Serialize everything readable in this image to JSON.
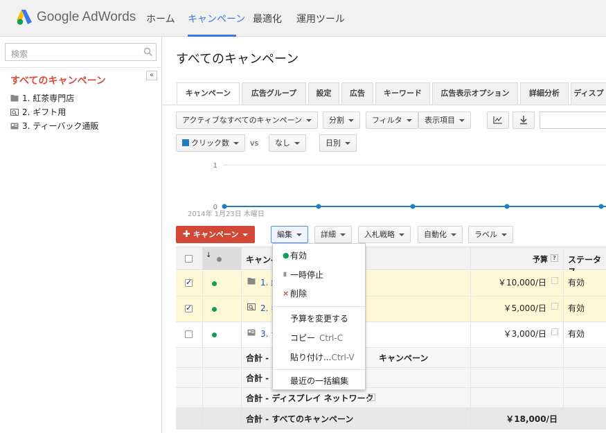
{
  "header": {
    "brand": "Google AdWords",
    "nav": [
      "ホーム",
      "キャンペーン",
      "最適化",
      "運用ツール"
    ],
    "active_nav": "キャンペーン"
  },
  "sidebar": {
    "search_placeholder": "検索",
    "title": "すべてのキャンペーン",
    "items": [
      {
        "label": "1. 紅茶専門店",
        "icon": "folder-icon"
      },
      {
        "label": "2. ギフト用",
        "icon": "search-campaign-icon"
      },
      {
        "label": "3. ティーバック通販",
        "icon": "display-campaign-icon"
      }
    ]
  },
  "main": {
    "title": "すべてのキャンペーン",
    "tabs": [
      "キャンペーン",
      "広告グループ",
      "設定",
      "広告",
      "キーワード",
      "広告表示オプション",
      "詳細分析",
      "ディスプ"
    ],
    "toolbar": {
      "filter_select": "アクティブなすべてのキャンペーン",
      "segment": "分割",
      "filter": "フィルタ",
      "columns": "表示項目"
    },
    "chart_controls": {
      "metric": "クリック数",
      "vs": "vs",
      "compare": "なし",
      "period": "日別"
    },
    "chart": {
      "y_top": "1",
      "y_zero": "0",
      "date_label": "2014年 1月23日 木曜日"
    },
    "actions": {
      "add_campaign": "キャンペーン",
      "edit": "編集",
      "details": "詳細",
      "bidding": "入札戦略",
      "automate": "自動化",
      "labels": "ラベル"
    },
    "table": {
      "headers": {
        "campaign": "キャンペ",
        "budget": "予算",
        "status": "ステータス"
      },
      "rows": [
        {
          "name": "1. 紅",
          "budget": "￥10,000/日",
          "status": "有効",
          "checked": true
        },
        {
          "name": "2. ギ",
          "budget": "￥5,000/日",
          "status": "有効",
          "checked": true
        },
        {
          "name": "3. テ",
          "budget": "￥3,000/日",
          "status": "有効",
          "checked": false
        }
      ],
      "totals": [
        {
          "label": "合計 - ",
          "tail": "キャンペーン"
        },
        {
          "label": "合計 - "
        },
        {
          "label": "合計 - ディスプレイ ネットワーク"
        }
      ],
      "grand_total": {
        "label": "合計 - すべてのキャンペーン",
        "budget": "￥18,000/日"
      }
    }
  },
  "edit_menu": {
    "items": [
      {
        "label": "有効"
      },
      {
        "label": "一時停止"
      },
      {
        "label": "削除"
      },
      {
        "label": "予算を変更する"
      },
      {
        "label": "コピー",
        "shortcut": "Ctrl-C"
      },
      {
        "label": "貼り付け...",
        "shortcut": "Ctrl-V"
      },
      {
        "label": "最近の一括編集"
      }
    ]
  },
  "colors": {
    "accent": "#3b78e7",
    "red": "#d14836",
    "selected_row": "#fff8d6",
    "series": "#1f7dc1",
    "status_green": "#0f9d58"
  }
}
